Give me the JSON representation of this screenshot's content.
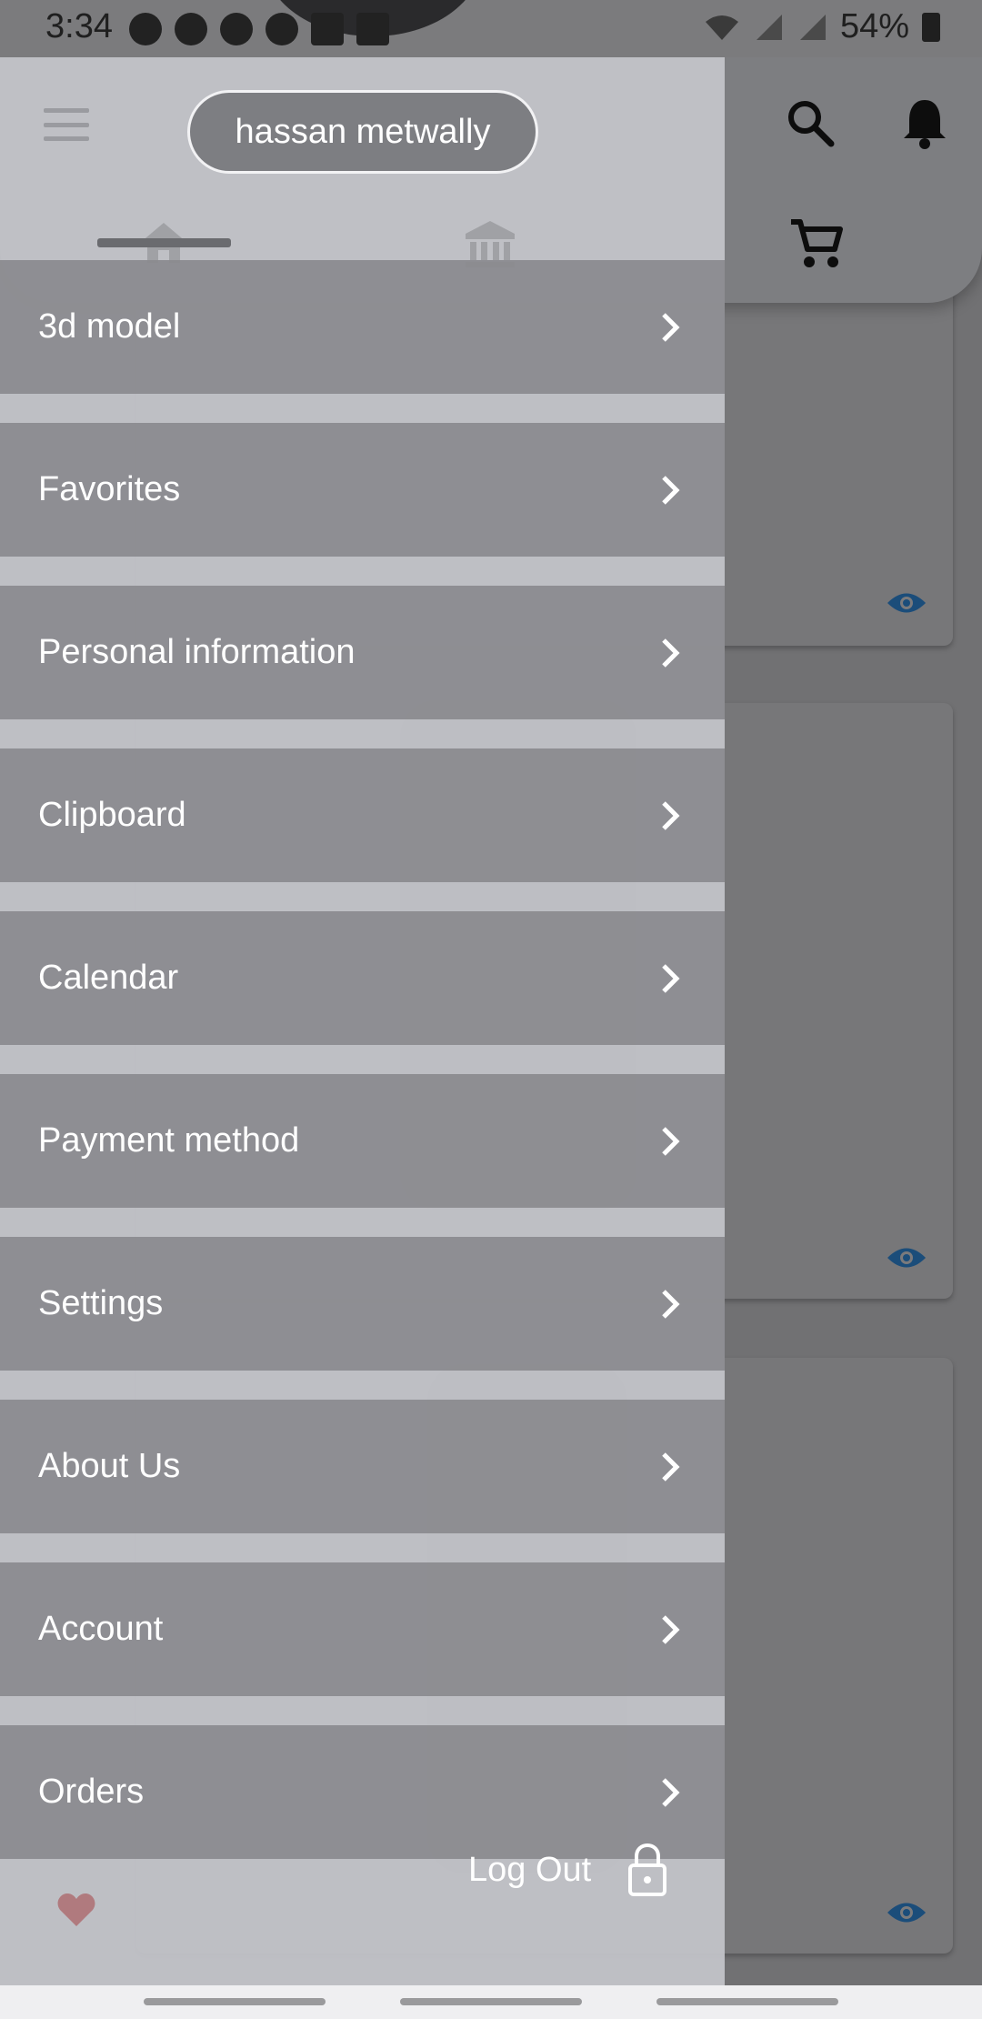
{
  "status_bar": {
    "time": "3:34",
    "battery": "54%",
    "notification_icons": [
      "facebook-icon",
      "pinterest-icon",
      "facebook-icon",
      "messenger-icon",
      "translate-icon",
      "gallery-icon"
    ]
  },
  "header": {
    "user_name": "hassan metwally",
    "nav_icons": [
      "home-icon",
      "bank-icon",
      "cart-icon"
    ],
    "action_icons": [
      "search-icon",
      "bell-icon"
    ]
  },
  "drawer": {
    "menu_items": [
      {
        "label": "3d model"
      },
      {
        "label": "Favorites"
      },
      {
        "label": "Personal information"
      },
      {
        "label": "Clipboard"
      },
      {
        "label": "Calendar"
      },
      {
        "label": "Payment method"
      },
      {
        "label": "Settings"
      },
      {
        "label": "About Us"
      },
      {
        "label": "Account"
      },
      {
        "label": "Orders"
      }
    ],
    "logout_label": "Log Out"
  },
  "colors": {
    "drawer_bg": "#c4c5ca",
    "menu_item_bg": "#8a8a8e",
    "eye_icon": "#1b4d7a",
    "heart_icon": "#b07a7e"
  }
}
